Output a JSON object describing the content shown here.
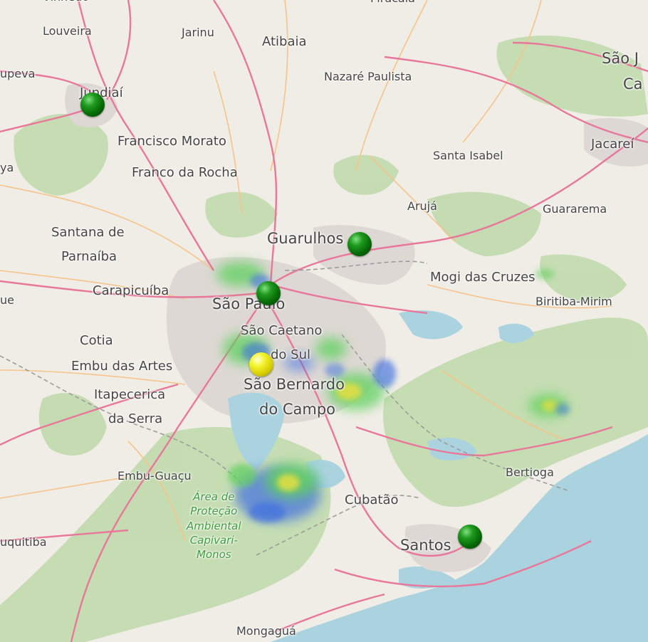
{
  "map": {
    "place_labels": [
      {
        "id": "vinhedo",
        "text": "Vinhedo",
        "size": "sm"
      },
      {
        "id": "piracaia",
        "text": "Piracaia",
        "size": "sm"
      },
      {
        "id": "louveira",
        "text": "Louveira",
        "size": "sm"
      },
      {
        "id": "jarinu",
        "text": "Jarinu",
        "size": "sm"
      },
      {
        "id": "atibaia",
        "text": "Atibaia",
        "size": "mid"
      },
      {
        "id": "sao-jose",
        "text": "São J",
        "size": "big"
      },
      {
        "id": "ca",
        "text": "Ca",
        "size": "big"
      },
      {
        "id": "itupeva",
        "text": "upeva",
        "size": "sm"
      },
      {
        "id": "jundiai",
        "text": "Jundiaí",
        "size": "mid"
      },
      {
        "id": "nazare-paulista",
        "text": "Nazaré Paulista",
        "size": "sm"
      },
      {
        "id": "francisco-morato",
        "text": "Francisco Morato",
        "size": "mid"
      },
      {
        "id": "franco-da-rocha",
        "text": "Franco da Rocha",
        "size": "mid"
      },
      {
        "id": "santa-isabel",
        "text": "Santa Isabel",
        "size": "sm"
      },
      {
        "id": "jacarei",
        "text": "Jacareí",
        "size": "mid"
      },
      {
        "id": "cajamar",
        "text": "ya",
        "size": "sm"
      },
      {
        "id": "aruja",
        "text": "Arujá",
        "size": "sm"
      },
      {
        "id": "guararema",
        "text": "Guararema",
        "size": "sm"
      },
      {
        "id": "santana-de-parnaiba-1",
        "text": "Santana de",
        "size": "mid"
      },
      {
        "id": "santana-de-parnaiba-2",
        "text": "Parnaíba",
        "size": "mid"
      },
      {
        "id": "guarulhos",
        "text": "Guarulhos",
        "size": "big"
      },
      {
        "id": "mogi-das-cruzes",
        "text": "Mogi das Cruzes",
        "size": "mid"
      },
      {
        "id": "carapicuiba",
        "text": "Carapicuíba",
        "size": "mid"
      },
      {
        "id": "sao-paulo",
        "text": "São Paulo",
        "size": "big"
      },
      {
        "id": "biritiba-mirim",
        "text": "Biritiba-Mirim",
        "size": "sm"
      },
      {
        "id": "aue",
        "text": "ue",
        "size": "sm"
      },
      {
        "id": "sao-caetano-1",
        "text": "São Caetano",
        "size": "mid"
      },
      {
        "id": "sao-caetano-2",
        "text": "do Sul",
        "size": "mid"
      },
      {
        "id": "cotia",
        "text": "Cotia",
        "size": "mid"
      },
      {
        "id": "embu-das-artes",
        "text": "Embu das Artes",
        "size": "mid"
      },
      {
        "id": "sao-bernardo-1",
        "text": "São Bernardo",
        "size": "big"
      },
      {
        "id": "sao-bernardo-2",
        "text": "do Campo",
        "size": "big"
      },
      {
        "id": "itapecerica-1",
        "text": "Itapecerica",
        "size": "mid"
      },
      {
        "id": "itapecerica-2",
        "text": "da Serra",
        "size": "mid"
      },
      {
        "id": "embu-guacu",
        "text": "Embu-Guaçu",
        "size": "sm"
      },
      {
        "id": "bertioga",
        "text": "Bertioga",
        "size": "sm"
      },
      {
        "id": "cubatao",
        "text": "Cubatão",
        "size": "mid"
      },
      {
        "id": "santos",
        "text": "Santos",
        "size": "big"
      },
      {
        "id": "juquitiba",
        "text": "uquitiba",
        "size": "sm"
      },
      {
        "id": "mongagua",
        "text": "Mongaguá",
        "size": "sm"
      }
    ],
    "park_label": [
      "Área de",
      "Proteção",
      "Ambiental",
      "Capivari-",
      "Monos"
    ],
    "markers": [
      {
        "id": "jundiai",
        "color": "green"
      },
      {
        "id": "guarulhos",
        "color": "green"
      },
      {
        "id": "sao-paulo",
        "color": "green"
      },
      {
        "id": "sao-bernardo",
        "color": "yellow"
      },
      {
        "id": "santos",
        "color": "green"
      }
    ],
    "colors": {
      "land": "#f0ede6",
      "forest": "#b9d7a3",
      "water": "#aad3df",
      "urban": "#ddd8d3",
      "road-major": "#e8779a",
      "road-minor": "#f6c48a",
      "heat-green": "#5fd05f",
      "heat-blue": "#3f6fe0",
      "heat-yellow": "#e6e040"
    }
  }
}
